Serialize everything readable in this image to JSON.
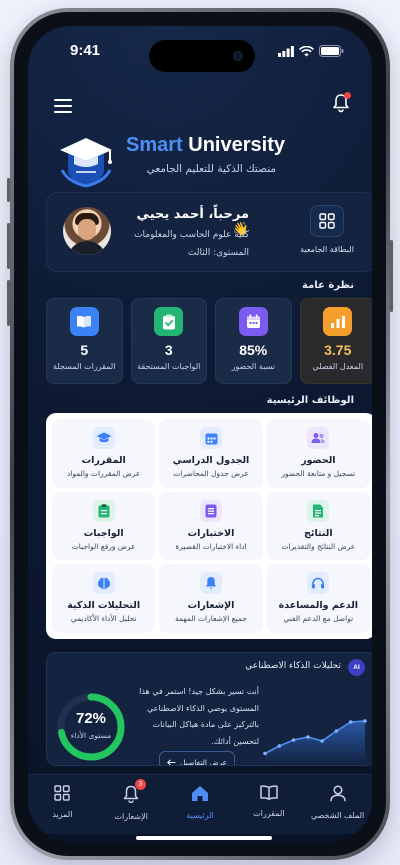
{
  "status": {
    "time": "9:41"
  },
  "brand": {
    "name_part1": "Smart",
    "name_part2": "University",
    "tagline": "منصتك الذكية للتعليم الجامعي"
  },
  "welcome": {
    "greeting": "مرحباً، أحمد يحيي 👋",
    "college": "كلية علوم الحاسب والمعلومات",
    "level": "المستوى: الثالث",
    "card_button_label": "البطاقة الجامعية"
  },
  "overview": {
    "title": "نظرة عامة",
    "stats": [
      {
        "value": "3.75",
        "label": "المعدل الفصلي",
        "icon": "chart-bar-icon",
        "color": "#f59e2b"
      },
      {
        "value": "85%",
        "label": "نسبة الحضور",
        "icon": "calendar-icon",
        "color": "#7c5cf0"
      },
      {
        "value": "3",
        "label": "الواجبات المستحقة",
        "icon": "clipboard-check-icon",
        "color": "#22b573"
      },
      {
        "value": "5",
        "label": "المقررات المسجلة",
        "icon": "book-icon",
        "color": "#3b82f6"
      }
    ]
  },
  "functions": {
    "title": "الوظائف الرئيسية",
    "items": [
      {
        "title": "الحضور",
        "subtitle": "تسجيل و متابعة الحضور",
        "icon": "users-icon",
        "color": "#7c5cf0",
        "bg": "#ece6fd"
      },
      {
        "title": "الجدول الدراسي",
        "subtitle": "عرض جدول المحاضرات",
        "icon": "calendar-icon",
        "color": "#3b82f6",
        "bg": "#e3ecfd"
      },
      {
        "title": "المقررات",
        "subtitle": "عرض المقررات والمواد",
        "icon": "graduation-cap-icon",
        "color": "#3b82f6",
        "bg": "#e3ecfd"
      },
      {
        "title": "النتائج",
        "subtitle": "عرض النتائج والتقديرات",
        "icon": "document-icon",
        "color": "#22b573",
        "bg": "#ddf5e9"
      },
      {
        "title": "الاختبارات",
        "subtitle": "اداء الاختبارات القصيرة",
        "icon": "list-icon",
        "color": "#7c5cf0",
        "bg": "#ece6fd"
      },
      {
        "title": "الواجبات",
        "subtitle": "عرض ورفع الواجبات",
        "icon": "clipboard-icon",
        "color": "#22b573",
        "bg": "#ddf5e9"
      },
      {
        "title": "الدعم والمساعدة",
        "subtitle": "تواصل مع الدعم الفني",
        "icon": "headset-icon",
        "color": "#3b82f6",
        "bg": "#e3ecfd"
      },
      {
        "title": "الإشعارات",
        "subtitle": "جميع الإشعارات المهمة",
        "icon": "bell-icon",
        "color": "#3b82f6",
        "bg": "#e3ecfd"
      },
      {
        "title": "التحليلات الذكية",
        "subtitle": "تحليل الأداء الأكاديمي",
        "icon": "brain-icon",
        "color": "#3b82f6",
        "bg": "#e3ecfd"
      }
    ]
  },
  "ai": {
    "badge": "AI",
    "title": "تحليلات الذكاء الاصطناعي",
    "text": "أنت تسير بشكل جيد! استمر في هذا المستوى يوصي الذكاء الاصطناعي بالتركيز على مادة هياكل البيانات لتحسين أدائك.",
    "button_label": "عرض التفاصيل",
    "performance_value": "72%",
    "performance_fraction": 0.72,
    "performance_label": "مستوى الأداء",
    "trend": [
      0.15,
      0.3,
      0.42,
      0.48,
      0.4,
      0.6,
      0.78,
      0.8
    ]
  },
  "tabbar": {
    "items": [
      {
        "label": "الملف الشخصي",
        "icon": "user-icon",
        "active": false
      },
      {
        "label": "المقررات",
        "icon": "open-book-icon",
        "active": false
      },
      {
        "label": "الرئيسية",
        "icon": "home-icon",
        "active": true
      },
      {
        "label": "الإشعارات",
        "icon": "bell-icon",
        "active": false,
        "badge": "3"
      },
      {
        "label": "المزيد",
        "icon": "grid-icon",
        "active": false
      }
    ]
  }
}
